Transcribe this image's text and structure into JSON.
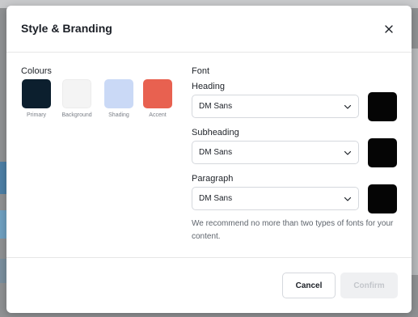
{
  "modal": {
    "title": "Style & Branding",
    "close_icon": "close-icon"
  },
  "colours": {
    "label": "Colours",
    "swatches": [
      {
        "name": "Primary",
        "color": "#0c1f2e"
      },
      {
        "name": "Background",
        "color": "#f4f4f4"
      },
      {
        "name": "Shading",
        "color": "#cad9f6"
      },
      {
        "name": "Accent",
        "color": "#e86150"
      }
    ]
  },
  "font": {
    "label": "Font",
    "rows": [
      {
        "label": "Heading",
        "value": "DM Sans",
        "color": "#050505"
      },
      {
        "label": "Subheading",
        "value": "DM Sans",
        "color": "#050505"
      },
      {
        "label": "Paragraph",
        "value": "DM Sans",
        "color": "#050505"
      }
    ],
    "hint": "We recommend no more than two types of fonts for your content."
  },
  "footer": {
    "cancel_label": "Cancel",
    "confirm_label": "Confirm"
  }
}
